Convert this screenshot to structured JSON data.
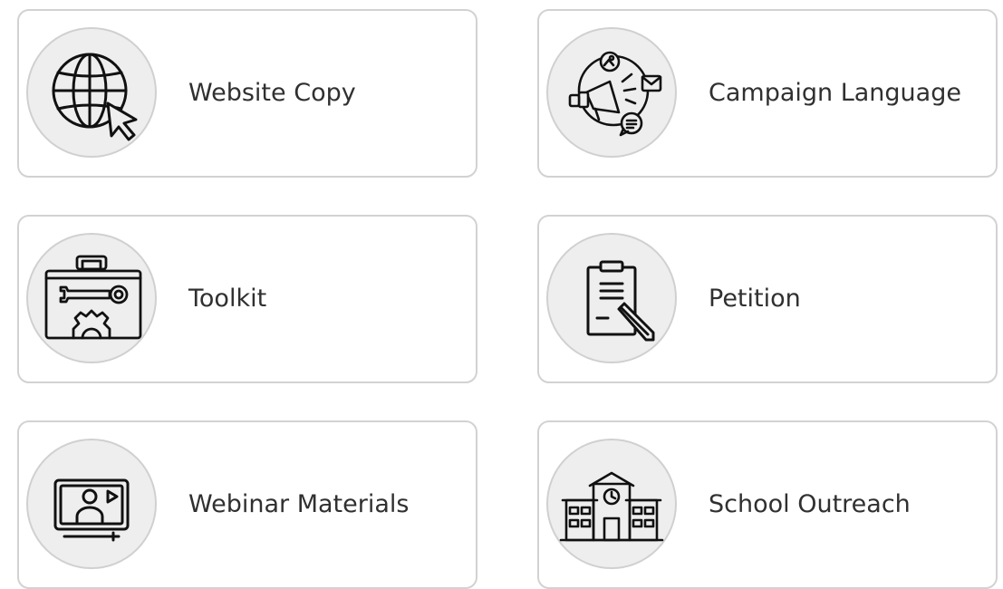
{
  "cards": [
    {
      "label": "Website Copy",
      "icon": "globe-cursor-icon"
    },
    {
      "label": "Campaign Language",
      "icon": "megaphone-icon"
    },
    {
      "label": "Toolkit",
      "icon": "toolbox-icon"
    },
    {
      "label": "Petition",
      "icon": "clipboard-pen-icon"
    },
    {
      "label": "Webinar Materials",
      "icon": "video-presenter-icon"
    },
    {
      "label": "School Outreach",
      "icon": "school-building-icon"
    }
  ],
  "colors": {
    "card_border": "#d2d2d2",
    "icon_circle_bg": "#eeeeee",
    "icon_stroke": "#111111",
    "label_text": "#303030"
  }
}
